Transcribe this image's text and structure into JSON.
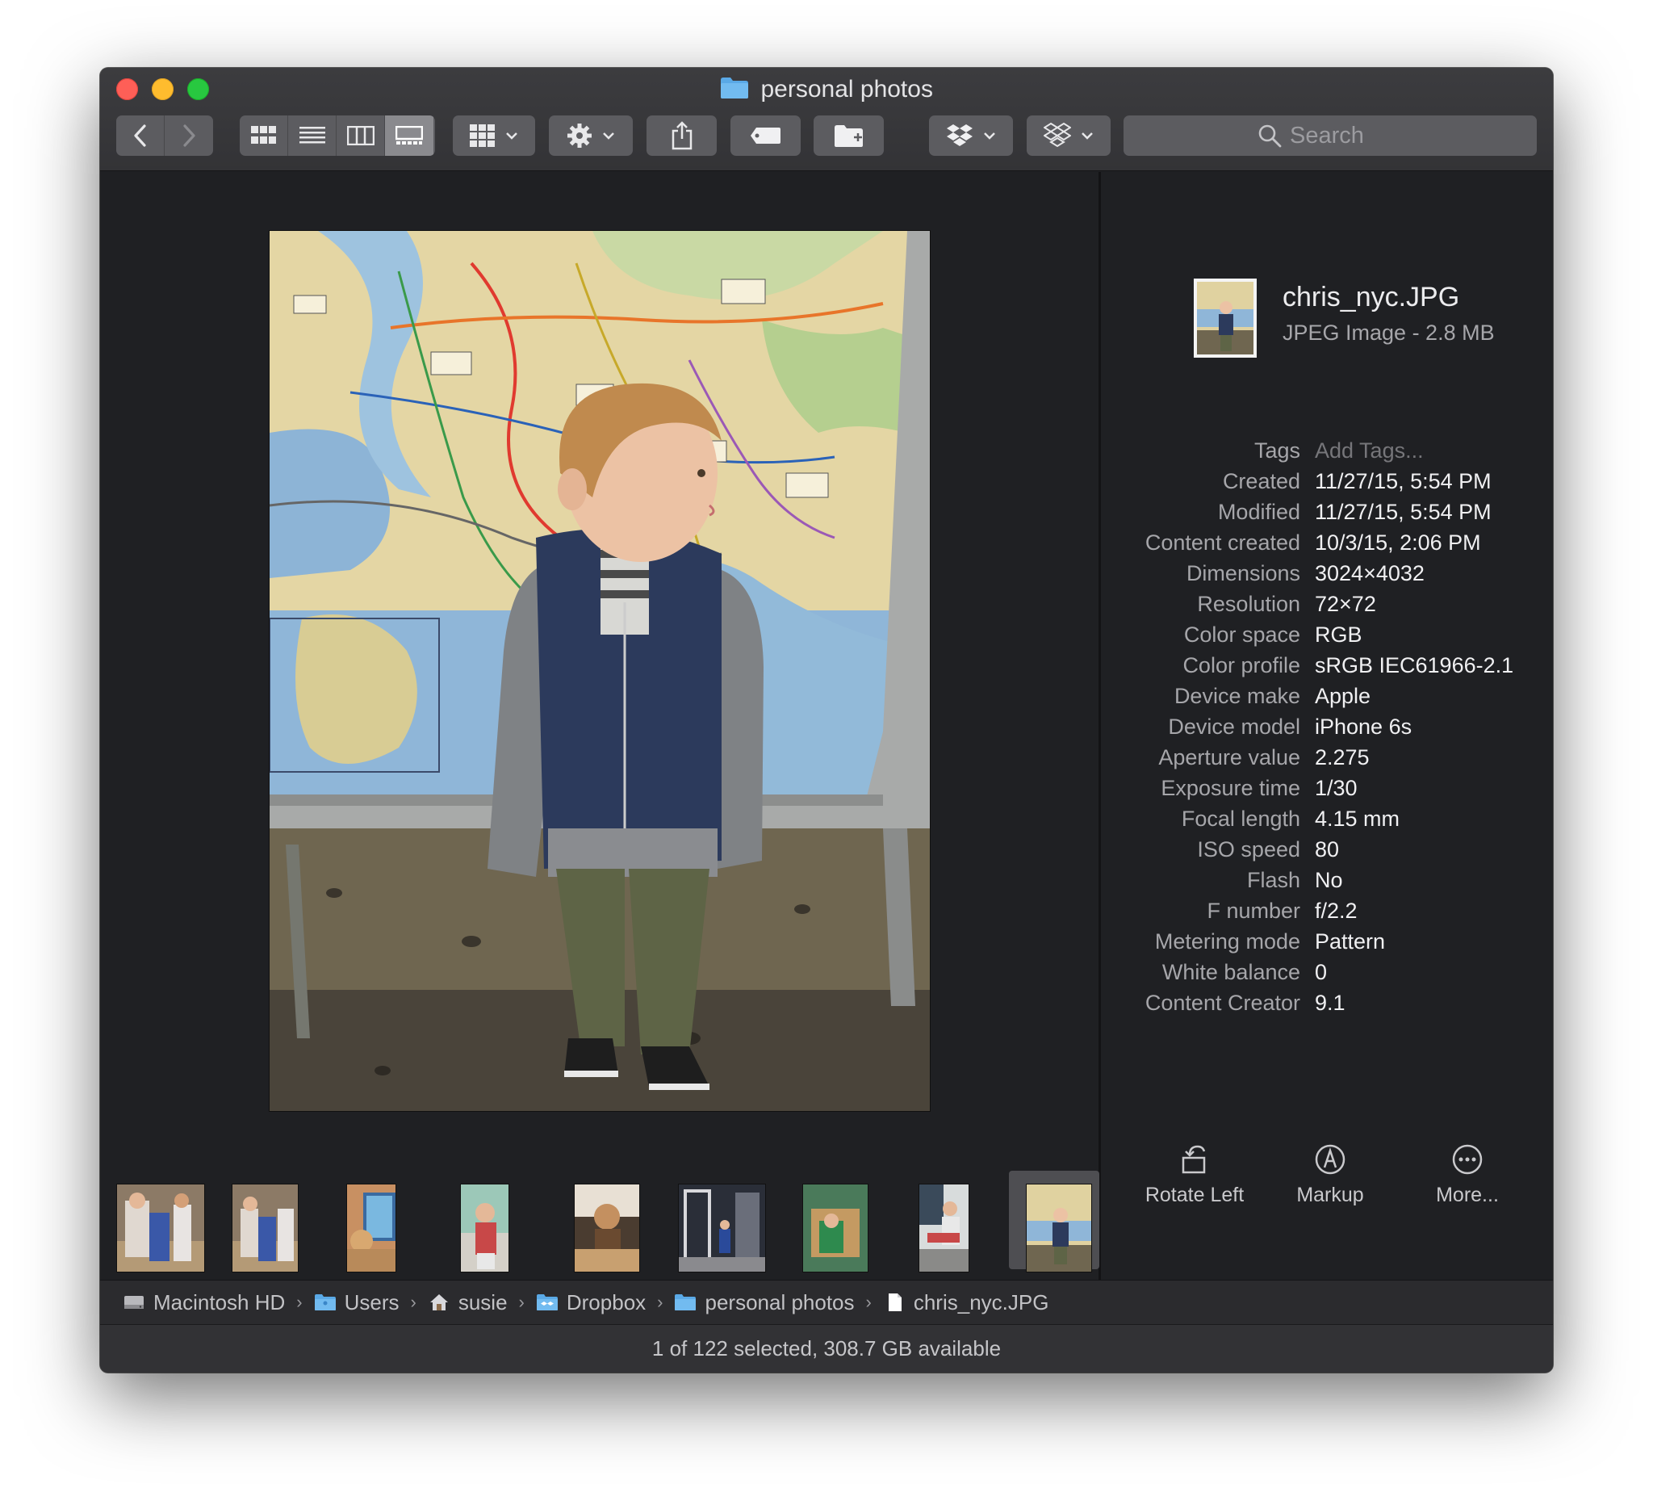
{
  "window": {
    "title": "personal photos"
  },
  "toolbar": {
    "back_icon": "chevron-left-icon",
    "forward_icon": "chevron-right-icon",
    "view_modes": [
      "icon-view-icon",
      "list-view-icon",
      "column-view-icon",
      "gallery-view-icon"
    ],
    "active_view": "gallery-view-icon",
    "group_icon": "grid-group-icon",
    "action_icon": "gear-icon",
    "share_icon": "share-icon",
    "tag_icon": "tag-icon",
    "new_folder_icon": "new-folder-icon",
    "dropbox_icon": "dropbox-icon",
    "dropbox2_icon": "dropbox-icon",
    "search_placeholder": "Search"
  },
  "filmstrip": {
    "thumbnails": [
      "thumb-1",
      "thumb-2",
      "thumb-3",
      "thumb-4",
      "thumb-5",
      "thumb-6",
      "thumb-7",
      "thumb-8",
      "thumb-9"
    ],
    "selected_index": 8
  },
  "inspector": {
    "file_name": "chris_nyc.JPG",
    "file_kind": "JPEG Image - 2.8 MB",
    "metadata": [
      {
        "label": "Tags",
        "value": "Add Tags..."
      },
      {
        "label": "Created",
        "value": "11/27/15, 5:54 PM"
      },
      {
        "label": "Modified",
        "value": "11/27/15, 5:54 PM"
      },
      {
        "label": "Content created",
        "value": "10/3/15, 2:06 PM"
      },
      {
        "label": "Dimensions",
        "value": "3024×4032"
      },
      {
        "label": "Resolution",
        "value": "72×72"
      },
      {
        "label": "Color space",
        "value": "RGB"
      },
      {
        "label": "Color profile",
        "value": "sRGB IEC61966-2.1"
      },
      {
        "label": "Device make",
        "value": "Apple"
      },
      {
        "label": "Device model",
        "value": "iPhone 6s"
      },
      {
        "label": "Aperture value",
        "value": "2.275"
      },
      {
        "label": "Exposure time",
        "value": "1/30"
      },
      {
        "label": "Focal length",
        "value": "4.15 mm"
      },
      {
        "label": "ISO speed",
        "value": "80"
      },
      {
        "label": "Flash",
        "value": "No"
      },
      {
        "label": "F number",
        "value": "f/2.2"
      },
      {
        "label": "Metering mode",
        "value": "Pattern"
      },
      {
        "label": "White balance",
        "value": "0"
      },
      {
        "label": "Content Creator",
        "value": "9.1"
      }
    ],
    "actions": [
      {
        "label": "Rotate Left",
        "icon": "rotate-left-icon"
      },
      {
        "label": "Markup",
        "icon": "markup-icon"
      },
      {
        "label": "More...",
        "icon": "more-icon"
      }
    ]
  },
  "pathbar": {
    "crumbs": [
      {
        "label": "Macintosh HD",
        "icon": "hard-drive-icon"
      },
      {
        "label": "Users",
        "icon": "folder-icon"
      },
      {
        "label": "susie",
        "icon": "home-icon"
      },
      {
        "label": "Dropbox",
        "icon": "dropbox-folder-icon"
      },
      {
        "label": "personal photos",
        "icon": "folder-icon"
      },
      {
        "label": "chris_nyc.JPG",
        "icon": "document-icon"
      }
    ]
  },
  "status": {
    "text": "1 of 122 selected, 308.7 GB available"
  },
  "colors": {
    "window_bg": "#1f2023",
    "toolbar_bg": "#3c3c3f",
    "button_bg": "#5c5c60",
    "folder_blue": "#5aa9e6",
    "close": "#fe5f57",
    "minimize": "#febc2e",
    "zoom": "#28c840"
  }
}
